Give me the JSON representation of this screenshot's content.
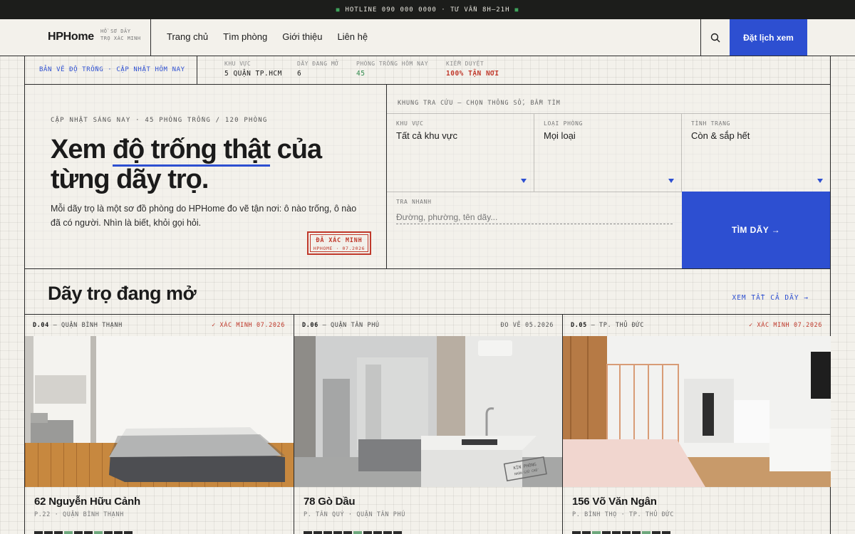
{
  "topbar": {
    "text": "HOTLINE 090 000 0000 · TƯ VẤN 8H–21H"
  },
  "header": {
    "brand": "HPHome",
    "tagline": "HỒ SƠ DÃY TRỌ XÁC MINH",
    "nav": [
      "Trang chủ",
      "Tìm phòng",
      "Giới thiệu",
      "Liên hệ"
    ],
    "search_icon": "search-icon",
    "cta": "Đặt lịch xem"
  },
  "status": {
    "title": "BẢN VẼ ĐỘ TRỐNG · CẬP NHẬT HÔM NAY",
    "stats": [
      {
        "label": "KHU VỰC",
        "value": "5 QUẬN TP.HCM",
        "color": "#1b1b1b"
      },
      {
        "label": "DÃY ĐANG MỞ",
        "value": "6",
        "color": "#1b1b1b"
      },
      {
        "label": "PHÒNG TRỐNG HÔM NAY",
        "value": "45",
        "color": "#2f8a4c"
      },
      {
        "label": "KIỂM DUYỆT",
        "value": "100% TẬN NƠI",
        "color": "#c0392b"
      }
    ]
  },
  "hero": {
    "kicker": "CẬP NHẬT SÁNG NAY · 45 PHÒNG TRỐNG / 120 PHÒNG",
    "headline_pre": "Xem ",
    "headline_highlight": "độ trống thật",
    "headline_post": " của từng dãy trọ.",
    "lead": "Mỗi dãy trọ là một sơ đồ phòng do HPHome đo vẽ tận nơi: ô nào trống, ô nào đã có người. Nhìn là biết, khỏi gọi hỏi.",
    "stamp_title": "ĐÃ XÁC MINH",
    "stamp_sub": "HPHOME · 07.2026"
  },
  "search_form": {
    "title": "KHUNG TRA CỨU — CHỌN THÔNG SỐ, BẤM TÌM",
    "fields": [
      {
        "label": "KHU VỰC",
        "value": "Tất cả khu vực"
      },
      {
        "label": "LOẠI PHÒNG",
        "value": "Mọi loại"
      },
      {
        "label": "TÌNH TRẠNG",
        "value": "Còn & sắp hết"
      }
    ],
    "quick_label": "TRA NHANH",
    "quick_placeholder": "Đường, phường, tên dãy...",
    "submit": "TÌM DÃY →"
  },
  "section": {
    "title": "Dãy trọ đang mở",
    "see_all": "XEM TẤT CẢ DÃY →"
  },
  "listings": [
    {
      "code": "D.04",
      "district": "QUẬN BÌNH THẠNH",
      "badge": "✓ XÁC MINH 07.2026",
      "badge_color": "red",
      "address": "62 Nguyễn Hữu Cảnh",
      "sub": "P.22 · QUẬN BÌNH THẠNH",
      "photo": "bedroom-photo"
    },
    {
      "code": "D.06",
      "district": "QUẬN TÂN PHÚ",
      "badge": "ĐO VẼ 05.2026",
      "badge_color": "grey",
      "address": "78 Gò Dầu",
      "sub": "P. TÂN QUÝ · QUẬN TÂN PHÚ",
      "photo": "studio-kitchen-photo",
      "photo_stamp": "KÍN PHÒNG · NHẬN GIỮ CHỖ"
    },
    {
      "code": "D.05",
      "district": "TP. THỦ ĐỨC",
      "badge": "✓ XÁC MINH 07.2026",
      "badge_color": "red",
      "address": "156 Võ Văn Ngân",
      "sub": "P. BÌNH THỌ · TP. THỦ ĐỨC",
      "photo": "open-studio-photo"
    }
  ],
  "colors": {
    "accent": "#2d4fd1",
    "verified": "#c0392b",
    "vacant": "#2f8a4c",
    "ink": "#1b1b1b",
    "paper": "#f3f1eb"
  }
}
